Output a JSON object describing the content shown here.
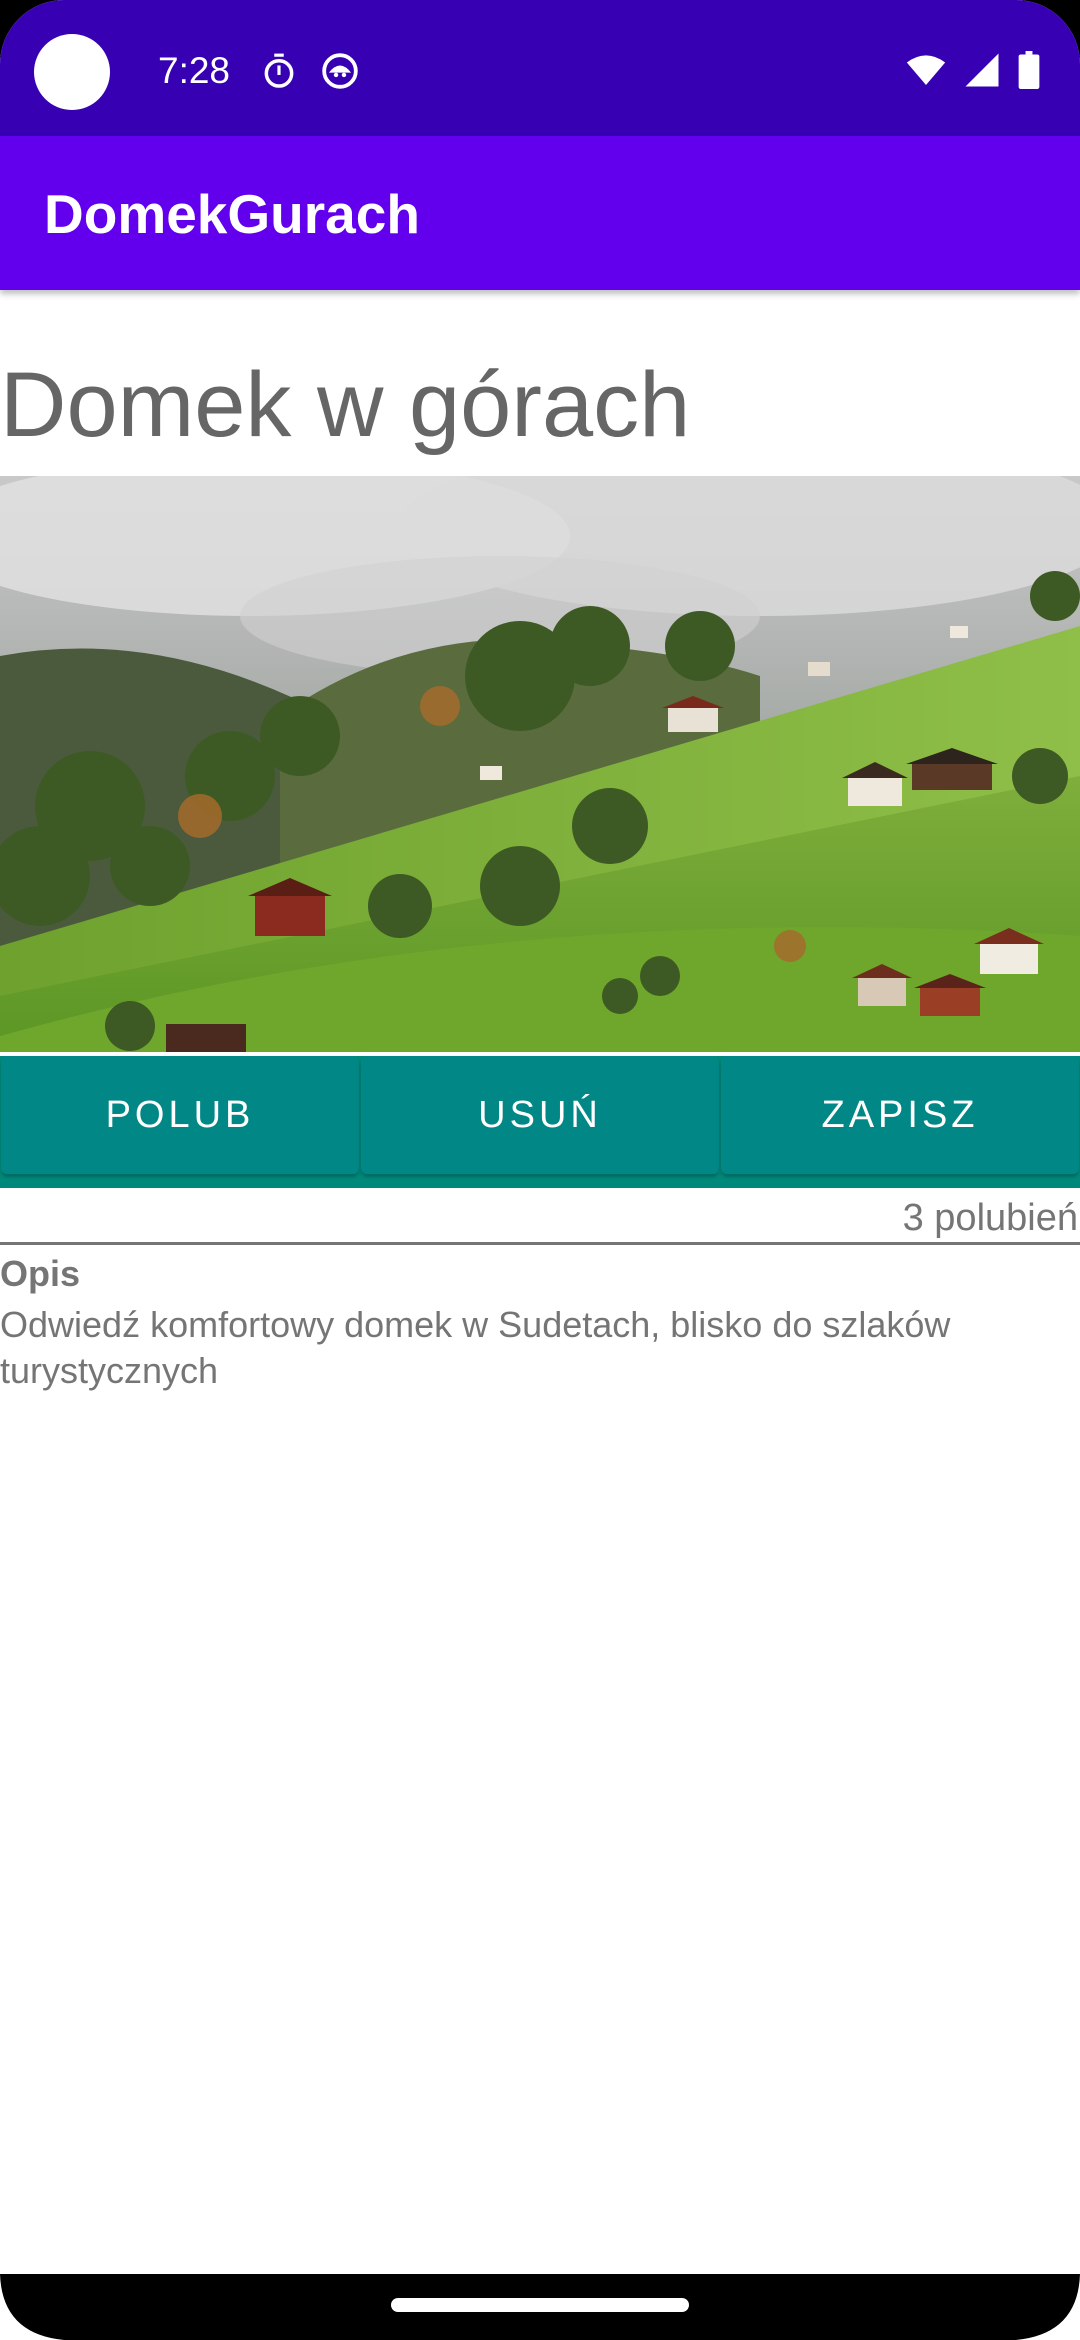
{
  "status_bar": {
    "time": "7:28",
    "icons_left": [
      "timer-icon",
      "android-notification-icon"
    ],
    "icons_right": [
      "wifi-icon",
      "cell-signal-icon",
      "battery-icon"
    ]
  },
  "app_bar": {
    "title": "DomekGurach"
  },
  "content": {
    "heading": "Domek w górach",
    "image": "mountain-cabins-photo",
    "buttons": {
      "like": "POLUB",
      "delete": "USUŃ",
      "save": "ZAPISZ"
    },
    "likes_count": "3 polubień",
    "description_label": "Opis",
    "description_text": "Odwiedź komfortowy domek w Sudetach, blisko do szlaków turystycznych"
  },
  "colors": {
    "status_bar": "#3700b3",
    "app_bar": "#6200ee",
    "button_bar": "#018786",
    "text_secondary": "#757575"
  }
}
